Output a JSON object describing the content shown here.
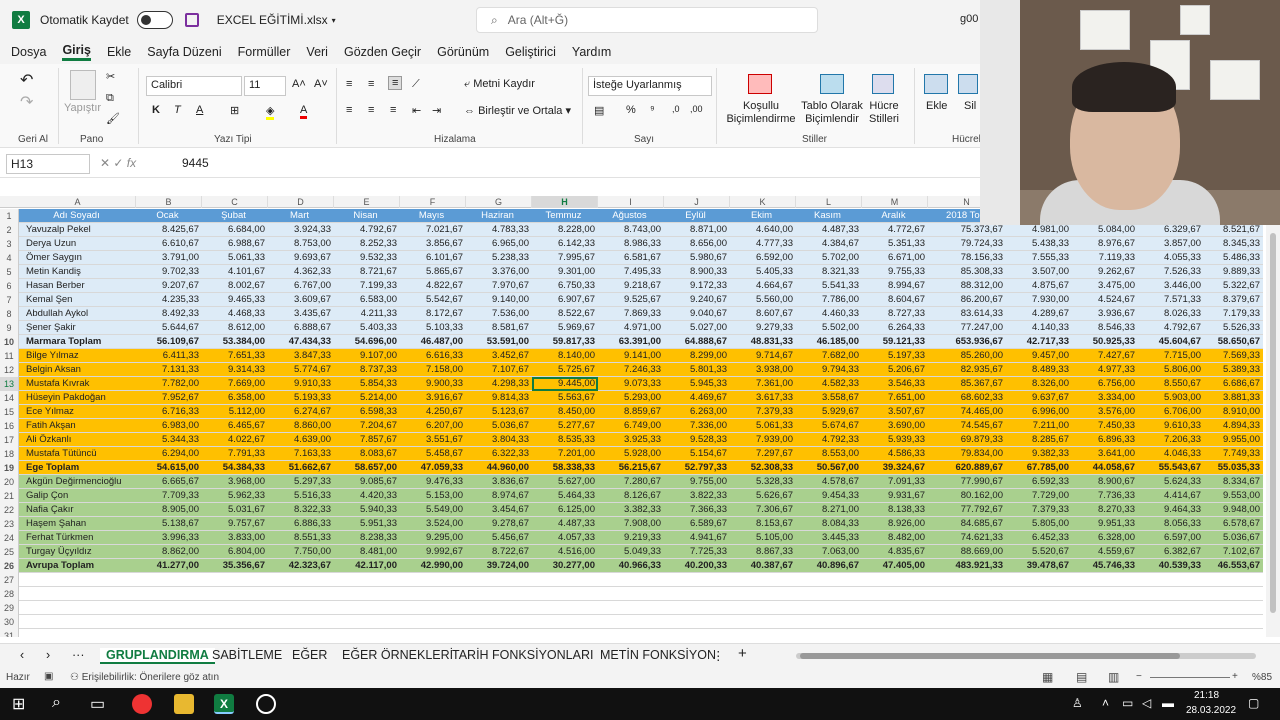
{
  "titlebar": {
    "autosave": "Otomatik Kaydet",
    "filename": "EXCEL EĞİTİMİ.xlsx",
    "search_placeholder": "Ara (Alt+Ğ)",
    "user": "g00"
  },
  "menu": [
    "Dosya",
    "Giriş",
    "Ekle",
    "Sayfa Düzeni",
    "Formüller",
    "Veri",
    "Gözden Geçir",
    "Görünüm",
    "Geliştirici",
    "Yardım"
  ],
  "ribbon": {
    "undo_group": "Geri Al",
    "paste": "Yapıştır",
    "clipboard_group": "Pano",
    "font_name": "Calibri",
    "font_size": "11",
    "font_group": "Yazı Tipi",
    "wrap_text": "Metni Kaydır",
    "merge_center": "Birleştir ve Ortala",
    "alignment_group": "Hizalama",
    "number_format": "İsteğe Uyarlanmış",
    "number_group": "Sayı",
    "cond_format": "Koşullu Biçimlendirme",
    "table_format": "Tablo Olarak Biçimlendir",
    "cell_styles": "Hücre Stilleri",
    "styles_group": "Stiller",
    "insert": "Ekle",
    "delete": "Sil",
    "cells_group": "Hücrel"
  },
  "formula_bar": {
    "name_box": "H13",
    "fx": "fx",
    "value": "9445"
  },
  "columns": [
    "A",
    "B",
    "C",
    "D",
    "E",
    "F",
    "G",
    "H",
    "I",
    "J",
    "K",
    "L",
    "M",
    "N",
    "",
    "",
    "",
    ""
  ],
  "rows": [
    {
      "n": "1",
      "style": "hdrrow",
      "cells": [
        "Adı Soyadı",
        "Ocak",
        "Şubat",
        "Mart",
        "Nisan",
        "Mayıs",
        "Haziran",
        "Temmuz",
        "Ağustos",
        "Eylül",
        "Ekim",
        "Kasım",
        "Aralık",
        "2018 Top",
        "",
        "",
        "",
        ""
      ]
    },
    {
      "n": "2",
      "style": "blue",
      "cells": [
        "Yavuzalp Pekel",
        "8.425,67",
        "6.684,00",
        "3.924,33",
        "4.792,67",
        "7.021,67",
        "4.783,33",
        "8.228,00",
        "8.743,00",
        "8.871,00",
        "4.640,00",
        "4.487,33",
        "4.772,67",
        "75.373,67",
        "4.981,00",
        "5.084,00",
        "6.329,67",
        "8.521,67"
      ]
    },
    {
      "n": "3",
      "style": "blue",
      "cells": [
        "Derya Uzun",
        "6.610,67",
        "6.988,67",
        "8.753,00",
        "8.252,33",
        "3.856,67",
        "6.965,00",
        "6.142,33",
        "8.986,33",
        "8.656,00",
        "4.777,33",
        "4.384,67",
        "5.351,33",
        "79.724,33",
        "5.438,33",
        "8.976,67",
        "3.857,00",
        "8.345,33"
      ]
    },
    {
      "n": "4",
      "style": "blue",
      "cells": [
        "Ömer Saygın",
        "3.791,00",
        "5.061,33",
        "9.693,67",
        "9.532,33",
        "6.101,67",
        "5.238,33",
        "7.995,67",
        "6.581,67",
        "5.980,67",
        "6.592,00",
        "5.702,00",
        "6.671,00",
        "78.156,33",
        "7.555,33",
        "7.119,33",
        "4.055,33",
        "5.486,33"
      ]
    },
    {
      "n": "5",
      "style": "blue",
      "cells": [
        "Metin Kandiş",
        "9.702,33",
        "4.101,67",
        "4.362,33",
        "8.721,67",
        "5.865,67",
        "3.376,00",
        "9.301,00",
        "7.495,33",
        "8.900,33",
        "5.405,33",
        "8.321,33",
        "9.755,33",
        "85.308,33",
        "3.507,00",
        "9.262,67",
        "7.526,33",
        "9.889,33"
      ]
    },
    {
      "n": "6",
      "style": "blue",
      "cells": [
        "Hasan Berber",
        "9.207,67",
        "8.002,67",
        "6.767,00",
        "7.199,33",
        "4.822,67",
        "7.970,67",
        "6.750,33",
        "9.218,67",
        "9.172,33",
        "4.664,67",
        "5.541,33",
        "8.994,67",
        "88.312,00",
        "4.875,67",
        "3.475,00",
        "3.446,00",
        "5.322,67"
      ]
    },
    {
      "n": "7",
      "style": "blue",
      "cells": [
        "Kemal Şen",
        "4.235,33",
        "9.465,33",
        "3.609,67",
        "6.583,00",
        "5.542,67",
        "9.140,00",
        "6.907,67",
        "9.525,67",
        "9.240,67",
        "5.560,00",
        "7.786,00",
        "8.604,67",
        "86.200,67",
        "7.930,00",
        "4.524,67",
        "7.571,33",
        "8.379,67"
      ]
    },
    {
      "n": "8",
      "style": "blue",
      "cells": [
        "Abdullah Aykol",
        "8.492,33",
        "4.468,33",
        "3.435,67",
        "4.211,33",
        "8.172,67",
        "7.536,00",
        "8.522,67",
        "7.869,33",
        "9.040,67",
        "8.607,67",
        "4.460,33",
        "8.727,33",
        "83.614,33",
        "4.289,67",
        "3.936,67",
        "8.026,33",
        "7.179,33"
      ]
    },
    {
      "n": "9",
      "style": "blue",
      "cells": [
        "Şener Şakir",
        "5.644,67",
        "8.612,00",
        "6.888,67",
        "5.403,33",
        "5.103,33",
        "8.581,67",
        "5.969,67",
        "4.971,00",
        "5.027,00",
        "9.279,33",
        "5.502,00",
        "6.264,33",
        "77.247,00",
        "4.140,33",
        "8.546,33",
        "4.792,67",
        "5.526,33"
      ]
    },
    {
      "n": "10",
      "style": "blue total",
      "cells": [
        "Marmara Toplam",
        "56.109,67",
        "53.384,00",
        "47.434,33",
        "54.696,00",
        "46.487,00",
        "53.591,00",
        "59.817,33",
        "63.391,00",
        "64.888,67",
        "48.831,33",
        "46.185,00",
        "59.121,33",
        "653.936,67",
        "42.717,33",
        "50.925,33",
        "45.604,67",
        "58.650,67"
      ]
    },
    {
      "n": "11",
      "style": "orange",
      "cells": [
        "Bilge Yılmaz",
        "6.411,33",
        "7.651,33",
        "3.847,33",
        "9.107,00",
        "6.616,33",
        "3.452,67",
        "8.140,00",
        "9.141,00",
        "8.299,00",
        "9.714,67",
        "7.682,00",
        "5.197,33",
        "85.260,00",
        "9.457,00",
        "7.427,67",
        "7.715,00",
        "7.569,33"
      ]
    },
    {
      "n": "12",
      "style": "orange",
      "cells": [
        "Belgin Aksan",
        "7.131,33",
        "9.314,33",
        "5.774,67",
        "8.737,33",
        "7.158,00",
        "7.107,67",
        "5.725,67",
        "7.246,33",
        "5.801,33",
        "3.938,00",
        "9.794,33",
        "5.206,67",
        "82.935,67",
        "8.489,33",
        "4.977,33",
        "5.806,00",
        "5.389,33"
      ]
    },
    {
      "n": "13",
      "style": "orange",
      "cells": [
        "Mustafa Kıvrak",
        "7.782,00",
        "7.669,00",
        "9.910,33",
        "5.854,33",
        "9.900,33",
        "4.298,33",
        "9.445,00",
        "9.073,33",
        "5.945,33",
        "7.361,00",
        "4.582,33",
        "3.546,33",
        "85.367,67",
        "8.326,00",
        "6.756,00",
        "8.550,67",
        "6.686,67"
      ]
    },
    {
      "n": "14",
      "style": "orange",
      "cells": [
        "Hüseyin Pakdoğan",
        "7.952,67",
        "6.358,00",
        "5.193,33",
        "5.214,00",
        "3.916,67",
        "9.814,33",
        "5.563,67",
        "5.293,00",
        "4.469,67",
        "3.617,33",
        "3.558,67",
        "7.651,00",
        "68.602,33",
        "9.637,67",
        "3.334,00",
        "5.903,00",
        "3.881,33"
      ]
    },
    {
      "n": "15",
      "style": "orange",
      "cells": [
        "Ece Yılmaz",
        "6.716,33",
        "5.112,00",
        "6.274,67",
        "6.598,33",
        "4.250,67",
        "5.123,67",
        "8.450,00",
        "8.859,67",
        "6.263,00",
        "7.379,33",
        "5.929,67",
        "3.507,67",
        "74.465,00",
        "6.996,00",
        "3.576,00",
        "6.706,00",
        "8.910,00"
      ]
    },
    {
      "n": "16",
      "style": "orange",
      "cells": [
        "Fatih Akşan",
        "6.983,00",
        "6.465,67",
        "8.860,00",
        "7.204,67",
        "6.207,00",
        "5.036,67",
        "5.277,67",
        "6.749,00",
        "7.336,00",
        "5.061,33",
        "5.674,67",
        "3.690,00",
        "74.545,67",
        "7.211,00",
        "7.450,33",
        "9.610,33",
        "4.894,33"
      ]
    },
    {
      "n": "17",
      "style": "orange",
      "cells": [
        "Ali Özkanlı",
        "5.344,33",
        "4.022,67",
        "4.639,00",
        "7.857,67",
        "3.551,67",
        "3.804,33",
        "8.535,33",
        "3.925,33",
        "9.528,33",
        "7.939,00",
        "4.792,33",
        "5.939,33",
        "69.879,33",
        "8.285,67",
        "6.896,33",
        "7.206,33",
        "9.955,00"
      ]
    },
    {
      "n": "18",
      "style": "orange",
      "cells": [
        "Mustafa Tütüncü",
        "6.294,00",
        "7.791,33",
        "7.163,33",
        "8.083,67",
        "5.458,67",
        "6.322,33",
        "7.201,00",
        "5.928,00",
        "5.154,67",
        "7.297,67",
        "8.553,00",
        "4.586,33",
        "79.834,00",
        "9.382,33",
        "3.641,00",
        "4.046,33",
        "7.749,33"
      ]
    },
    {
      "n": "19",
      "style": "orange total",
      "cells": [
        "Ege Toplam",
        "54.615,00",
        "54.384,33",
        "51.662,67",
        "58.657,00",
        "47.059,33",
        "44.960,00",
        "58.338,33",
        "56.215,67",
        "52.797,33",
        "52.308,33",
        "50.567,00",
        "39.324,67",
        "620.889,67",
        "67.785,00",
        "44.058,67",
        "55.543,67",
        "55.035,33"
      ]
    },
    {
      "n": "20",
      "style": "green",
      "cells": [
        "Akgün Değirmencioğlu",
        "6.665,67",
        "3.968,00",
        "5.297,33",
        "9.085,67",
        "9.476,33",
        "3.836,67",
        "5.627,00",
        "7.280,67",
        "9.755,00",
        "5.328,33",
        "4.578,67",
        "7.091,33",
        "77.990,67",
        "6.592,33",
        "8.900,67",
        "5.624,33",
        "8.334,67"
      ]
    },
    {
      "n": "21",
      "style": "green",
      "cells": [
        "Galip Çon",
        "7.709,33",
        "5.962,33",
        "5.516,33",
        "4.420,33",
        "5.153,00",
        "8.974,67",
        "5.464,33",
        "8.126,67",
        "3.822,33",
        "5.626,67",
        "9.454,33",
        "9.931,67",
        "80.162,00",
        "7.729,00",
        "7.736,33",
        "4.414,67",
        "9.553,00"
      ]
    },
    {
      "n": "22",
      "style": "green",
      "cells": [
        "Nafia Çakır",
        "8.905,00",
        "5.031,67",
        "8.322,33",
        "5.940,33",
        "5.549,00",
        "3.454,67",
        "6.125,00",
        "3.382,33",
        "7.366,33",
        "7.306,67",
        "8.271,00",
        "8.138,33",
        "77.792,67",
        "7.379,33",
        "8.270,33",
        "9.464,33",
        "9.948,00"
      ]
    },
    {
      "n": "23",
      "style": "green",
      "cells": [
        "Haşem Şahan",
        "5.138,67",
        "9.757,67",
        "6.886,33",
        "5.951,33",
        "3.524,00",
        "9.278,67",
        "4.487,33",
        "7.908,00",
        "6.589,67",
        "8.153,67",
        "8.084,33",
        "8.926,00",
        "84.685,67",
        "5.805,00",
        "9.951,33",
        "8.056,33",
        "6.578,67"
      ]
    },
    {
      "n": "24",
      "style": "green",
      "cells": [
        "Ferhat Türkmen",
        "3.996,33",
        "3.833,00",
        "8.551,33",
        "8.238,33",
        "9.295,00",
        "5.456,67",
        "4.057,33",
        "9.219,33",
        "4.941,67",
        "5.105,00",
        "3.445,33",
        "8.482,00",
        "74.621,33",
        "6.452,33",
        "6.328,00",
        "6.597,00",
        "5.036,67"
      ]
    },
    {
      "n": "25",
      "style": "green",
      "cells": [
        "Turgay Üçyıldız",
        "8.862,00",
        "6.804,00",
        "7.750,00",
        "8.481,00",
        "9.992,67",
        "8.722,67",
        "4.516,00",
        "5.049,33",
        "7.725,33",
        "8.867,33",
        "7.063,00",
        "4.835,67",
        "88.669,00",
        "5.520,67",
        "4.559,67",
        "6.382,67",
        "7.102,67"
      ]
    },
    {
      "n": "26",
      "style": "green total",
      "cells": [
        "Avrupa Toplam",
        "41.277,00",
        "35.356,67",
        "42.323,67",
        "42.117,00",
        "42.990,00",
        "39.724,00",
        "30.277,00",
        "40.966,33",
        "40.200,33",
        "40.387,67",
        "40.896,67",
        "47.405,00",
        "483.921,33",
        "39.478,67",
        "45.746,33",
        "40.539,33",
        "46.553,67"
      ]
    },
    {
      "n": "27",
      "style": "",
      "cells": []
    },
    {
      "n": "28",
      "style": "",
      "cells": []
    },
    {
      "n": "29",
      "style": "",
      "cells": []
    },
    {
      "n": "30",
      "style": "",
      "cells": []
    },
    {
      "n": "31",
      "style": "",
      "cells": []
    },
    {
      "n": "32",
      "style": "",
      "cells": []
    }
  ],
  "sheet_tabs": [
    "GRUPLANDIRMA",
    "SABİTLEME",
    "EĞER",
    "EĞER ÖRNEKLERİ",
    "TARİH FONKSİYONLARI",
    "METİN FONKSİYON"
  ],
  "status": {
    "ready": "Hazır",
    "accessibility": "Erişilebilirlik: Önerilere göz atın",
    "zoom": "%85"
  },
  "taskbar": {
    "time": "21:18",
    "date": "28.03.2022"
  }
}
